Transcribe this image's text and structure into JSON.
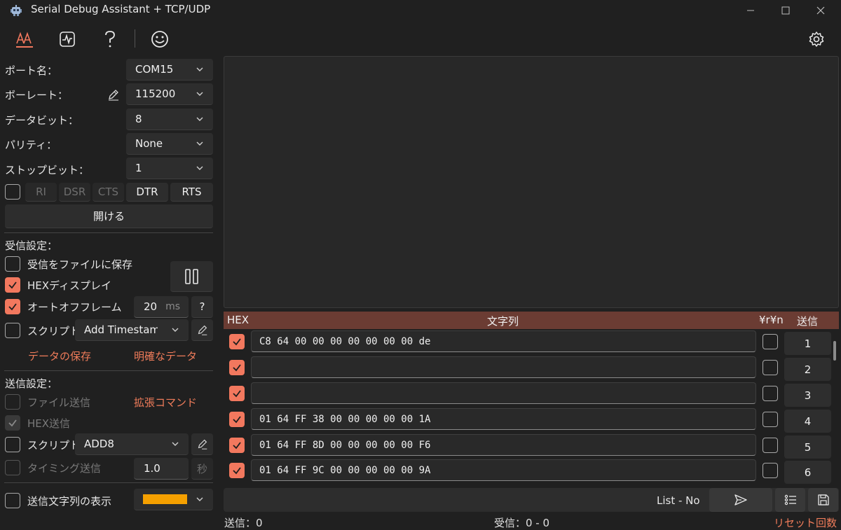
{
  "window": {
    "title": "Serial Debug Assistant + TCP/UDP"
  },
  "icons": {
    "app": "robot-icon",
    "font": "font-color-icon",
    "wave": "waveform-icon",
    "help": "question-icon",
    "smile": "smiley-icon",
    "settings": "gear-icon",
    "minimize": "minimize-icon",
    "maximize": "maximize-icon",
    "close": "close-icon",
    "chevron": "chevron-down-icon",
    "edit": "pen-icon",
    "send": "send-arrow-icon",
    "list": "list-icon",
    "save": "save-icon",
    "check": "check-icon",
    "refresh": "refresh-icon"
  },
  "colors": {
    "accent": "#f2785e",
    "header": "#6b3c33",
    "swatch": "#f5a000"
  },
  "serial": {
    "port_label": "ポート名：",
    "port_value": "COM15",
    "baud_label": "ボーレート：",
    "baud_value": "115200",
    "databits_label": "データビット：",
    "databits_value": "8",
    "parity_label": "パリティ：",
    "parity_value": "None",
    "stopbits_label": "ストップビット：",
    "stopbits_value": "1",
    "signals": [
      "RI",
      "DSR",
      "CTS",
      "DTR",
      "RTS"
    ],
    "open_label": "開ける"
  },
  "receive": {
    "title": "受信設定：",
    "save_to_file": "受信をファイルに保存",
    "hex_display": "HEXディスプレイ",
    "auto_frame": "オートオフフレーム",
    "frame_ms": "20",
    "ms_unit": "ms",
    "help": "?",
    "script_label": "スクリプト",
    "script_value": "Add Timestamp",
    "save_data": "データの保存",
    "clear_data": "明確なデータ"
  },
  "send": {
    "title": "送信設定：",
    "file_send": "ファイル送信",
    "ext_command": "拡張コマンド",
    "hex_send": "HEX送信",
    "script_label": "スクリプト",
    "script_value": "ADD8",
    "timing_send": "タイミング送信",
    "timing_value": "1.0",
    "sec_unit": "秒",
    "show_send_string": "送信文字列の表示"
  },
  "table": {
    "headers": {
      "hex": "HEX",
      "string": "文字列",
      "crlf": "¥r¥n",
      "send": "送信"
    },
    "rows": [
      {
        "hex": true,
        "text": "C8 64 00 00 00 00 00 00 00 de",
        "crlf": false,
        "send": "1"
      },
      {
        "hex": true,
        "text": "",
        "crlf": false,
        "send": "2"
      },
      {
        "hex": true,
        "text": "",
        "crlf": false,
        "send": "3"
      },
      {
        "hex": true,
        "text": "01 64 FF 38 00 00 00 00 00 1A",
        "crlf": false,
        "send": "4"
      },
      {
        "hex": true,
        "text": "01 64 FF 8D 00 00 00 00 00 F6",
        "crlf": false,
        "send": "5"
      },
      {
        "hex": true,
        "text": "01 64 FF 9C 00 00 00 00 00 9A",
        "crlf": false,
        "send": "6"
      }
    ]
  },
  "bottom": {
    "list_label": "List - No"
  },
  "status": {
    "sent": "送信：0",
    "received": "受信：0 - 0",
    "reset": "リセット回数"
  }
}
